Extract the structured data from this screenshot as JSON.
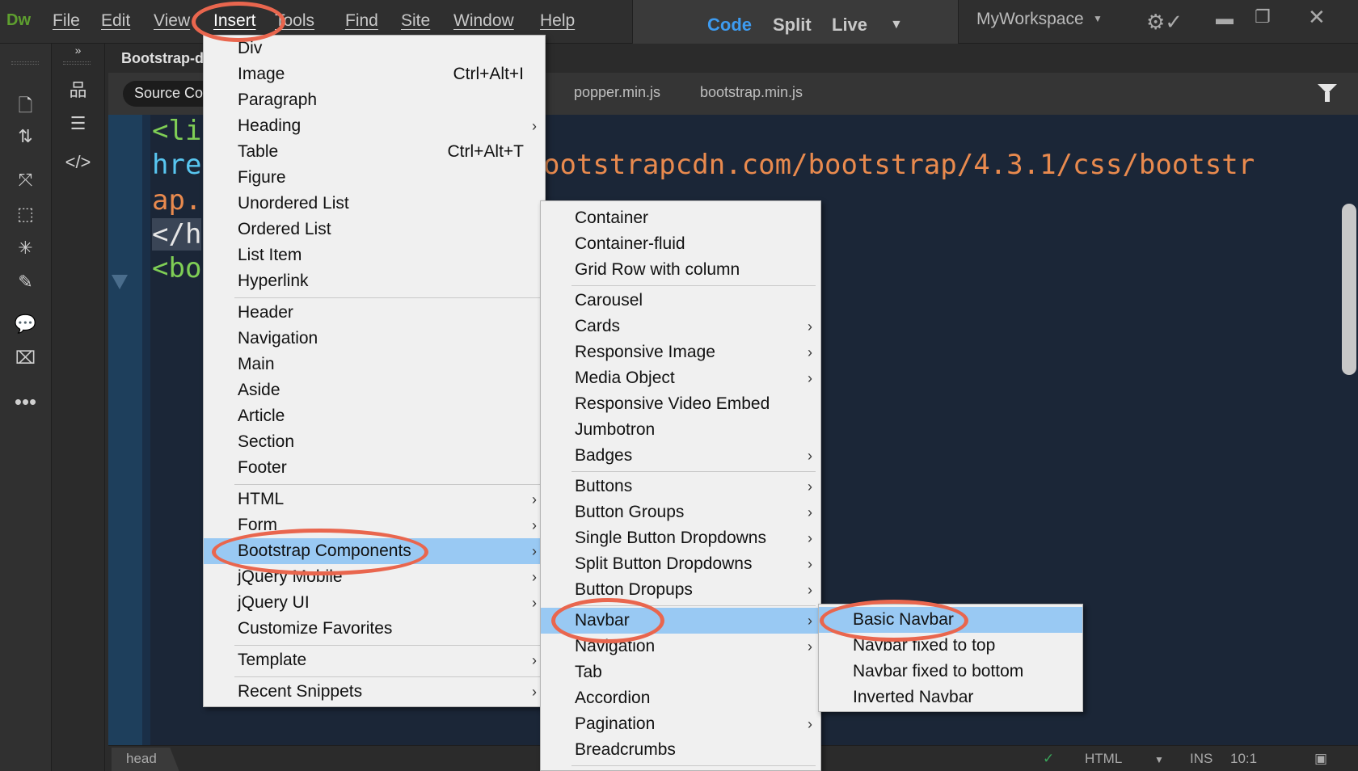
{
  "menubar": {
    "logo": "Dw",
    "items": [
      "File",
      "Edit",
      "View",
      "Insert",
      "Tools",
      "Find",
      "Site",
      "Window",
      "Help"
    ],
    "views": [
      "Code",
      "Split",
      "Live"
    ],
    "workspace": "MyWorkspace",
    "accent_color": "#3d9bf0"
  },
  "document": {
    "title": "Bootstrap-d",
    "source_tab": "Source Code",
    "related_files": [
      "popper.min.js",
      "bootstrap.min.js"
    ]
  },
  "code": {
    "line1": "<li",
    "line2_start": "hre",
    "line2_end": "ootstrapcdn.com/bootstrap/4.3.1/css/bootstr",
    "line3": "ap.",
    "line4": "</h",
    "line5": "<bo"
  },
  "status": {
    "crumb": "head",
    "language": "HTML",
    "mode": "INS",
    "position": "10:1"
  },
  "insert_menu": {
    "items": [
      {
        "label": "Div",
        "shortcut": "",
        "submenu": false
      },
      {
        "label": "Image",
        "shortcut": "Ctrl+Alt+I",
        "submenu": false
      },
      {
        "label": "Paragraph",
        "shortcut": "",
        "submenu": false
      },
      {
        "label": "Heading",
        "shortcut": "",
        "submenu": true
      },
      {
        "label": "Table",
        "shortcut": "Ctrl+Alt+T",
        "submenu": false
      },
      {
        "label": "Figure",
        "shortcut": "",
        "submenu": false
      },
      {
        "label": "Unordered List",
        "shortcut": "",
        "submenu": false
      },
      {
        "label": "Ordered List",
        "shortcut": "",
        "submenu": false
      },
      {
        "label": "List Item",
        "shortcut": "",
        "submenu": false
      },
      {
        "label": "Hyperlink",
        "shortcut": "",
        "submenu": false
      },
      {
        "label": "Header",
        "shortcut": "",
        "submenu": false
      },
      {
        "label": "Navigation",
        "shortcut": "",
        "submenu": false
      },
      {
        "label": "Main",
        "shortcut": "",
        "submenu": false
      },
      {
        "label": "Aside",
        "shortcut": "",
        "submenu": false
      },
      {
        "label": "Article",
        "shortcut": "",
        "submenu": false
      },
      {
        "label": "Section",
        "shortcut": "",
        "submenu": false
      },
      {
        "label": "Footer",
        "shortcut": "",
        "submenu": false
      },
      {
        "label": "HTML",
        "shortcut": "",
        "submenu": true
      },
      {
        "label": "Form",
        "shortcut": "",
        "submenu": true
      },
      {
        "label": "Bootstrap Components",
        "shortcut": "",
        "submenu": true
      },
      {
        "label": "jQuery Mobile",
        "shortcut": "",
        "submenu": true
      },
      {
        "label": "jQuery UI",
        "shortcut": "",
        "submenu": true
      },
      {
        "label": "Customize Favorites",
        "shortcut": "",
        "submenu": false
      },
      {
        "label": "Template",
        "shortcut": "",
        "submenu": true
      },
      {
        "label": "Recent Snippets",
        "shortcut": "",
        "submenu": true
      }
    ]
  },
  "bootstrap_menu": {
    "items": [
      {
        "label": "Container",
        "submenu": false
      },
      {
        "label": "Container-fluid",
        "submenu": false
      },
      {
        "label": "Grid Row with column",
        "submenu": false
      },
      {
        "label": "Carousel",
        "submenu": false
      },
      {
        "label": "Cards",
        "submenu": true
      },
      {
        "label": "Responsive Image",
        "submenu": true
      },
      {
        "label": "Media Object",
        "submenu": true
      },
      {
        "label": "Responsive Video Embed",
        "submenu": false
      },
      {
        "label": "Jumbotron",
        "submenu": false
      },
      {
        "label": "Badges",
        "submenu": true
      },
      {
        "label": "Buttons",
        "submenu": true
      },
      {
        "label": "Button Groups",
        "submenu": true
      },
      {
        "label": "Single Button Dropdowns",
        "submenu": true
      },
      {
        "label": "Split Button Dropdowns",
        "submenu": true
      },
      {
        "label": "Button Dropups",
        "submenu": true
      },
      {
        "label": "Navbar",
        "submenu": true
      },
      {
        "label": "Navigation",
        "submenu": true
      },
      {
        "label": "Tab",
        "submenu": false
      },
      {
        "label": "Accordion",
        "submenu": false
      },
      {
        "label": "Pagination",
        "submenu": true
      },
      {
        "label": "Breadcrumbs",
        "submenu": false
      }
    ]
  },
  "navbar_menu": {
    "items": [
      {
        "label": "Basic Navbar"
      },
      {
        "label": "Navbar fixed to top"
      },
      {
        "label": "Navbar fixed to bottom"
      },
      {
        "label": "Inverted Navbar"
      }
    ]
  },
  "colors": {
    "highlight": "#99c9f3",
    "annotation_ring": "#e9664e",
    "code_tag": "#7fce55",
    "code_attr": "#58c6f0",
    "code_string": "#e98a4e"
  }
}
